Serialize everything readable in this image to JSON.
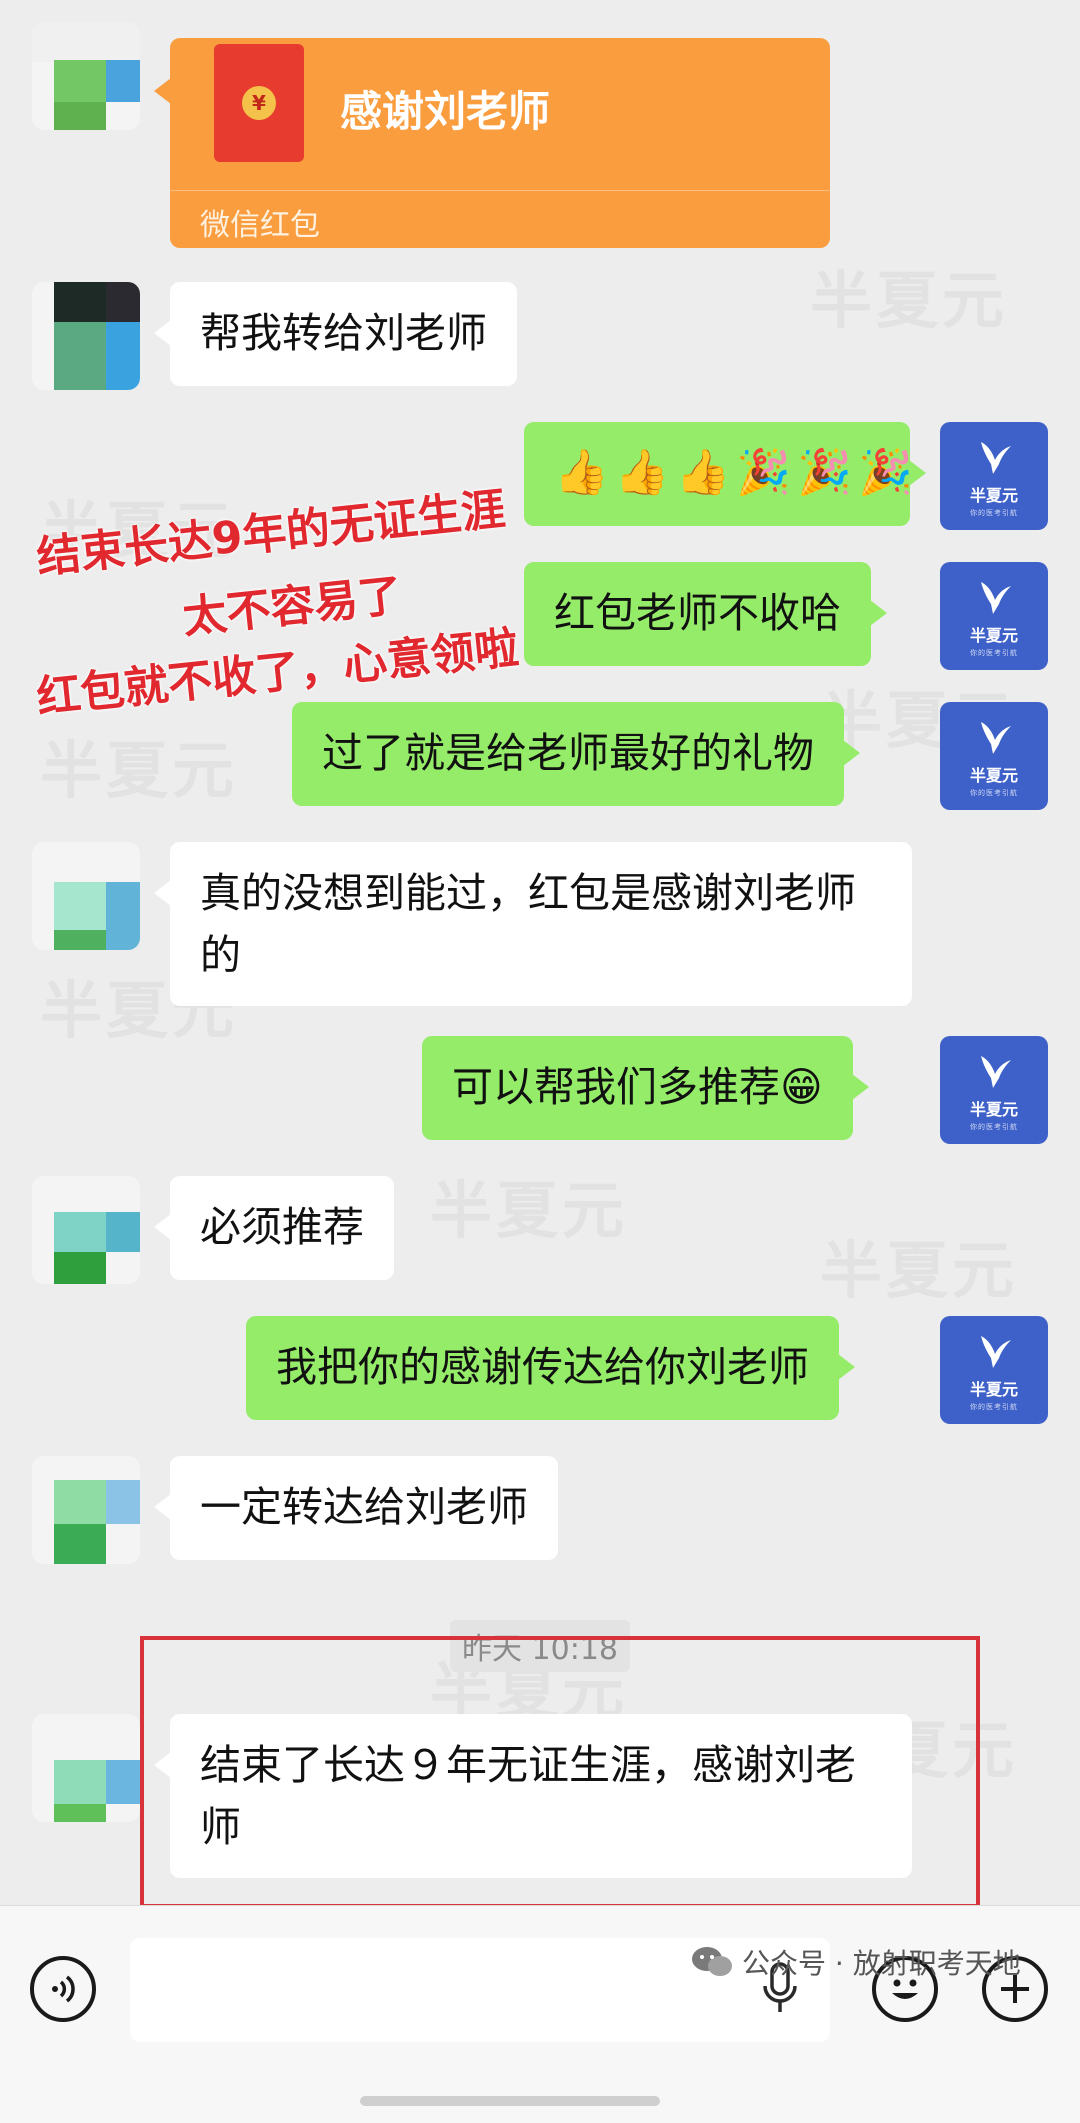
{
  "watermark_text": "半夏元",
  "red_packet": {
    "title": "感谢刘老师",
    "label": "微信红包",
    "coin": "¥"
  },
  "messages": [
    {
      "side": "left",
      "text": "帮我转给刘老师"
    },
    {
      "side": "right",
      "emojis": [
        "👍",
        "👍",
        "👍",
        "🎉",
        "🎉",
        "🎉"
      ]
    },
    {
      "side": "right",
      "text": "红包老师不收哈"
    },
    {
      "side": "right",
      "text": "过了就是给老师最好的礼物"
    },
    {
      "side": "left",
      "text": "真的没想到能过，红包是感谢刘老师的"
    },
    {
      "side": "right",
      "text": "可以帮我们多推荐😁"
    },
    {
      "side": "left",
      "text": "必须推荐"
    },
    {
      "side": "right",
      "text": "我把你的感谢传达给你刘老师"
    },
    {
      "side": "left",
      "text": "一定转达给刘老师"
    },
    {
      "side": "left",
      "text": "结束了长达９年无证生涯，感谢刘老师"
    }
  ],
  "agent_avatar": {
    "brand": "半夏元",
    "sub": "你的医考引航"
  },
  "annotation": {
    "line1": "结束长达9年的无证生涯",
    "line2": "太不容易了",
    "line3": "红包就不收了，心意领啦"
  },
  "timestamp": "昨天 10:18",
  "footer": {
    "source": "公众号 · 放射职考天地"
  },
  "colors": {
    "chat_bg": "#ededed",
    "self_bubble": "#95ec69",
    "other_bubble": "#ffffff",
    "red_packet": "#f99d3f",
    "annotation_red": "#e0282e",
    "agent_avatar_bg": "#3e61c9"
  },
  "icons": {
    "voice_button": "voice-icon",
    "mic_in_field": "microphone-icon",
    "emoji_button": "smiley-icon",
    "plus_button": "plus-icon"
  }
}
